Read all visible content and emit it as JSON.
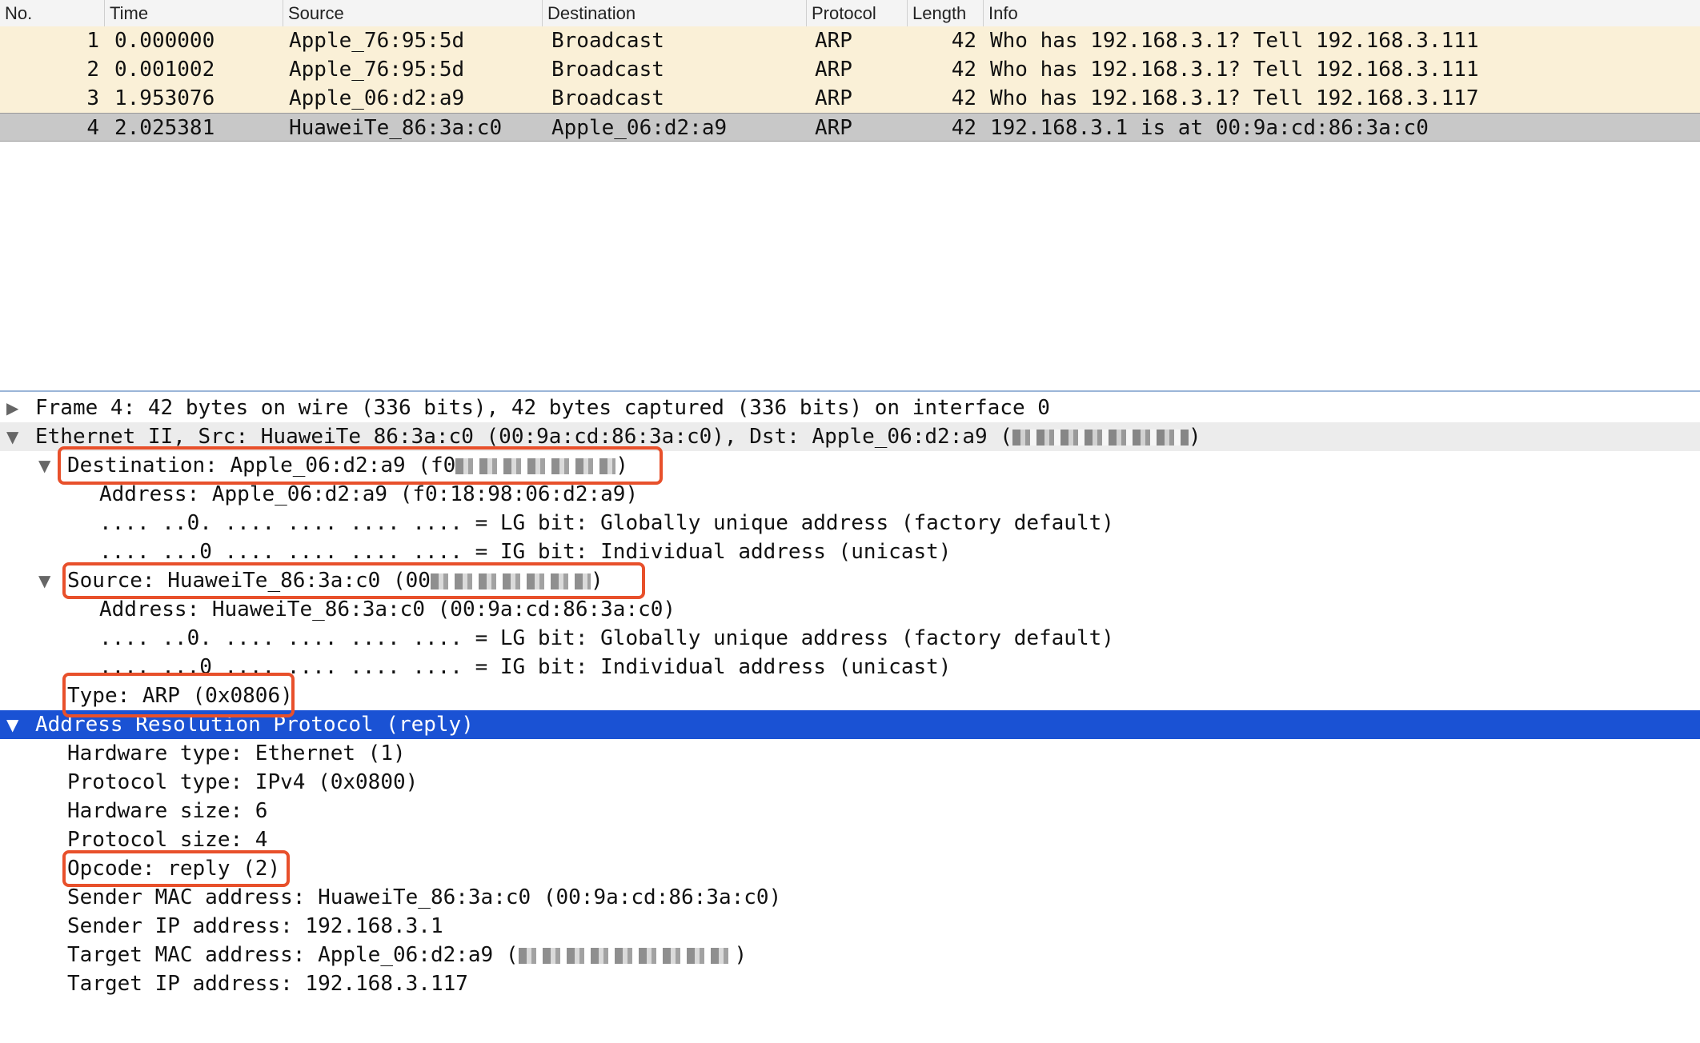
{
  "columns": [
    "No.",
    "Time",
    "Source",
    "Destination",
    "Protocol",
    "Length",
    "Info"
  ],
  "packets": [
    {
      "no": "1",
      "time": "0.000000",
      "source": "Apple_76:95:5d",
      "destination": "Broadcast",
      "protocol": "ARP",
      "length": "42",
      "info": "Who has 192.168.3.1? Tell 192.168.3.111"
    },
    {
      "no": "2",
      "time": "0.001002",
      "source": "Apple_76:95:5d",
      "destination": "Broadcast",
      "protocol": "ARP",
      "length": "42",
      "info": "Who has 192.168.3.1? Tell 192.168.3.111"
    },
    {
      "no": "3",
      "time": "1.953076",
      "source": "Apple_06:d2:a9",
      "destination": "Broadcast",
      "protocol": "ARP",
      "length": "42",
      "info": "Who has 192.168.3.1? Tell 192.168.3.117"
    },
    {
      "no": "4",
      "time": "2.025381",
      "source": "HuaweiTe_86:3a:c0",
      "destination": "Apple_06:d2:a9",
      "protocol": "ARP",
      "length": "42",
      "info": "192.168.3.1 is at 00:9a:cd:86:3a:c0"
    }
  ],
  "details": {
    "frame": "Frame 4: 42 bytes on wire (336 bits), 42 bytes captured (336 bits) on interface 0",
    "ethernet": "Ethernet II, Src: HuaweiTe_86:3a:c0 (00:9a:cd:86:3a:c0), Dst: Apple_06:d2:a9 (",
    "destination": "Destination: Apple_06:d2:a9 (f0",
    "dst_address": "Address: Apple_06:d2:a9 (f0:18:98:06:d2:a9)",
    "dst_lg": ".... ..0. .... .... .... .... = LG bit: Globally unique address (factory default)",
    "dst_ig": ".... ...0 .... .... .... .... = IG bit: Individual address (unicast)",
    "source": "Source: HuaweiTe_86:3a:c0 (00",
    "src_address": "Address: HuaweiTe_86:3a:c0 (00:9a:cd:86:3a:c0)",
    "src_lg": ".... ..0. .... .... .... .... = LG bit: Globally unique address (factory default)",
    "src_ig": ".... ...0 .... .... .... .... = IG bit: Individual address (unicast)",
    "type": "Type: ARP (0x0806)",
    "arp": "Address Resolution Protocol (reply)",
    "hw_type": "Hardware type: Ethernet (1)",
    "proto_type": "Protocol type: IPv4 (0x0800)",
    "hw_size": "Hardware size: 6",
    "proto_size": "Protocol size: 4",
    "opcode": "Opcode: reply (2)",
    "sender_mac": "Sender MAC address: HuaweiTe_86:3a:c0 (00:9a:cd:86:3a:c0)",
    "sender_ip": "Sender IP address: 192.168.3.1",
    "target_mac": "Target MAC address: Apple_06:d2:a9 (",
    "target_ip": "Target IP address: 192.168.3.117"
  },
  "colors": {
    "arp_row": "#faf0d7",
    "selected_row": "#c8c8c8",
    "selected_detail": "#1a52d4",
    "highlight_box": "#e8502b"
  }
}
